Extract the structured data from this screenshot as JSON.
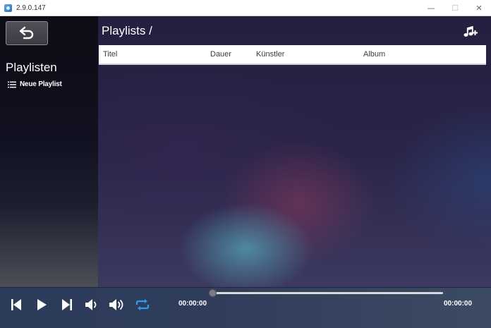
{
  "window": {
    "title": "2.9.0.147",
    "minimize_glyph": "—",
    "maximize_glyph": "☐",
    "close_glyph": "✕"
  },
  "sidebar": {
    "back_icon": "back-arrow-icon",
    "title": "Playlisten",
    "items": [
      {
        "label": "Neue Playlist",
        "icon": "list-icon"
      }
    ]
  },
  "main": {
    "breadcrumb": "Playlists /",
    "add_icon": "add-music-icon",
    "columns": {
      "titel": "Titel",
      "dauer": "Dauer",
      "kuenstler": "Künstler",
      "album": "Album"
    }
  },
  "player": {
    "current_time": "00:00:00",
    "total_time": "00:00:00",
    "progress": 0,
    "repeat_active": true,
    "accent_color": "#2a9fe8",
    "icons": [
      "previous-icon",
      "play-icon",
      "next-icon",
      "volume-down-icon",
      "volume-up-icon",
      "repeat-icon"
    ]
  }
}
